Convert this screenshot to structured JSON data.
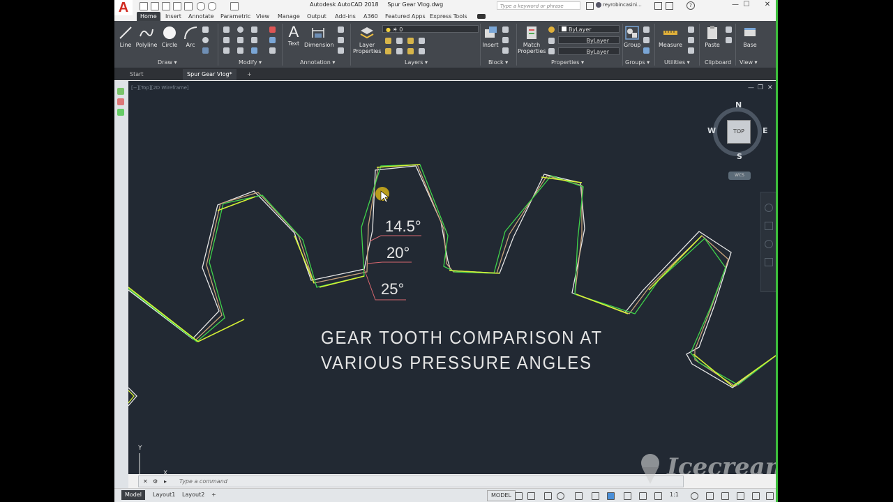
{
  "titlebar": {
    "app_title": "Autodesk AutoCAD 2018     Spur Gear Vlog.dwg",
    "logo": "A",
    "search_placeholder": "Type a keyword or phrase",
    "user": "reyrobincasini..."
  },
  "ribbon_tabs": [
    "Home",
    "Insert",
    "Annotate",
    "Parametric",
    "View",
    "Manage",
    "Output",
    "Add-ins",
    "A360",
    "Featured Apps",
    "Express Tools"
  ],
  "ribbon": {
    "draw": {
      "line": "Line",
      "polyline": "Polyline",
      "circle": "Circle",
      "arc": "Arc",
      "panel": "Draw ▾"
    },
    "modify": {
      "panel": "Modify ▾"
    },
    "annotation": {
      "text": "Text",
      "dimension": "Dimension",
      "panel": "Annotation ▾"
    },
    "layers": {
      "layer_props_1": "Layer",
      "layer_props_2": "Properties",
      "current_layer": "0",
      "panel": "Layers ▾"
    },
    "block": {
      "insert": "Insert",
      "panel": "Block ▾"
    },
    "properties": {
      "match_1": "Match",
      "match_2": "Properties",
      "color": "ByLayer",
      "linetype": "ByLayer",
      "lineweight": "ByLayer",
      "panel": "Properties ▾"
    },
    "groups": {
      "group": "Group",
      "panel": "Groups ▾"
    },
    "utilities": {
      "measure": "Measure",
      "panel": "Utilities ▾"
    },
    "clipboard": {
      "paste": "Paste",
      "panel": "Clipboard"
    },
    "view": {
      "base": "Base",
      "panel": "View ▾"
    }
  },
  "file_tabs": [
    "Start",
    "Spur Gear Vlog*",
    "+"
  ],
  "viewport": {
    "label": "[−][Top][2D Wireframe]",
    "viewcube": {
      "n": "N",
      "s": "S",
      "e": "E",
      "w": "W",
      "face": "TOP",
      "wcs": "WCS"
    },
    "annotations": {
      "a1": "14.5°",
      "a2": "20°",
      "a3": "25°"
    },
    "heading_line1": "GEAR TOOTH COMPARISON AT",
    "heading_line2": "VARIOUS PRESSURE ANGLES",
    "ucs_y": "Y",
    "ucs_x": "X"
  },
  "command_placeholder": "Type a command",
  "layout_tabs": [
    "Model",
    "Layout1",
    "Layout2",
    "+"
  ],
  "status": {
    "model": "MODEL",
    "scale": "1:1"
  },
  "watermark": "Icecream",
  "colors": {
    "accent_green": "#d4f035",
    "outline_white": "#e6e6e6",
    "tan": "#c8a27a",
    "green": "#3fd34a",
    "dim_red": "#d8676f",
    "bg": "#222933"
  }
}
